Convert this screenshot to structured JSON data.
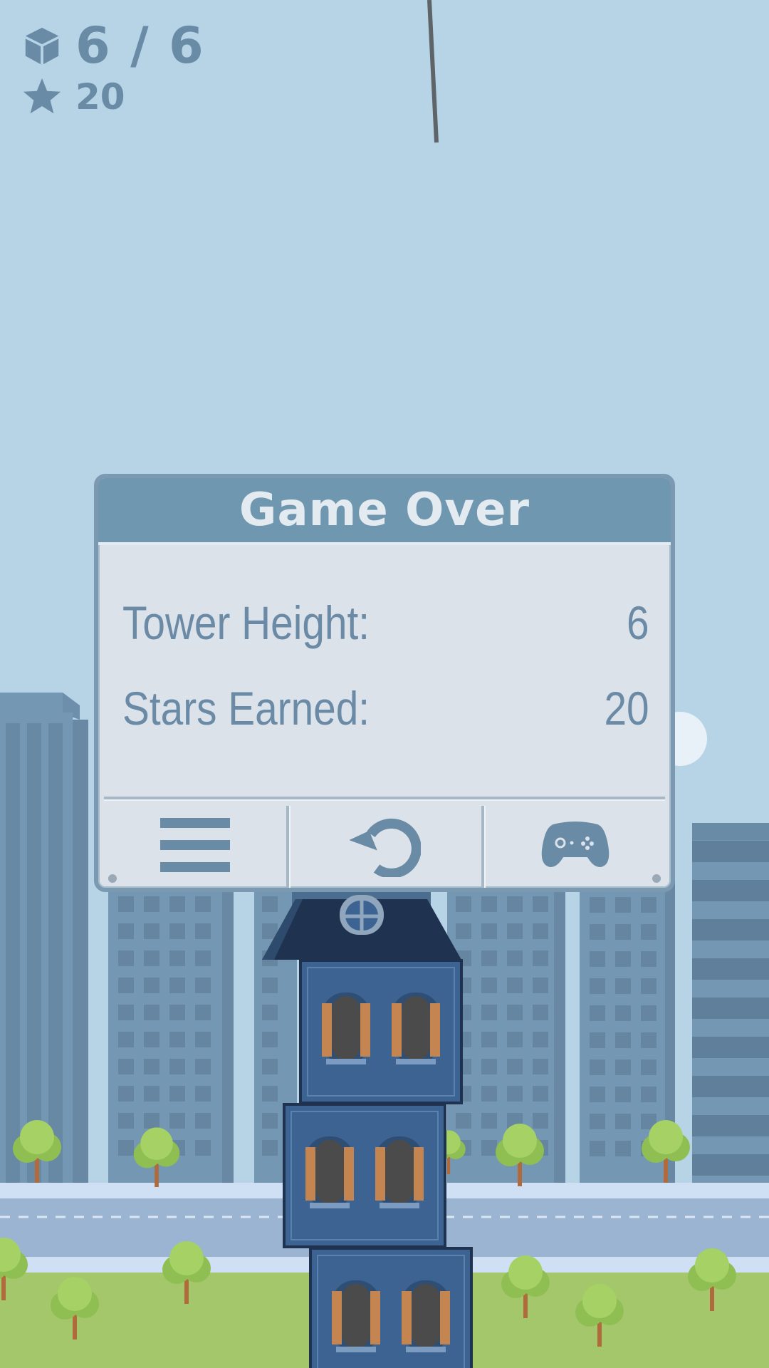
{
  "hud": {
    "blocks": "6 / 6",
    "stars": "20",
    "blocks_icon": "cube-icon",
    "stars_icon": "star-icon"
  },
  "modal": {
    "title": "Game Over",
    "stats": [
      {
        "label": "Tower Height:",
        "value": "6"
      },
      {
        "label": "Stars Earned:",
        "value": "20"
      }
    ],
    "buttons": [
      {
        "name": "menu",
        "icon": "hamburger-menu-icon"
      },
      {
        "name": "retry",
        "icon": "restart-icon"
      },
      {
        "name": "more-games",
        "icon": "gamepad-icon"
      }
    ]
  },
  "colors": {
    "sky": "#b6d4e6",
    "ui_text": "#6a8ba5",
    "modal_header": "#6f97b0",
    "modal_body": "#dbe2ea",
    "tower_block": "#3c6391",
    "grass": "#a4c76b"
  }
}
